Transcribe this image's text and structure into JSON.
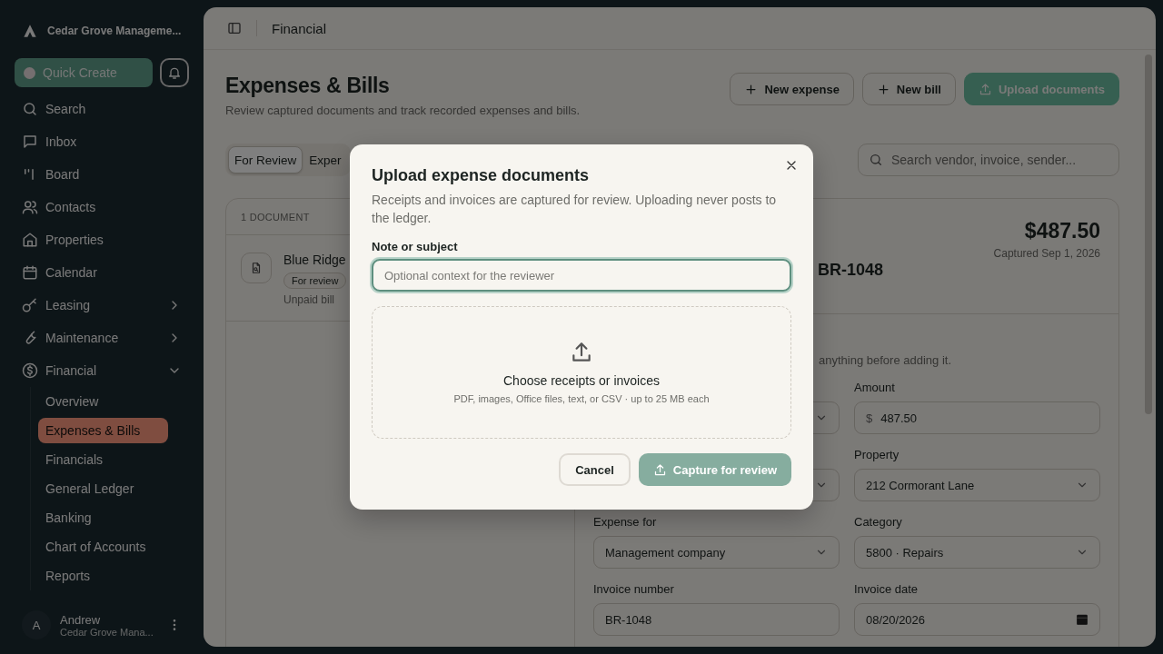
{
  "sidebar": {
    "brand": "Cedar Grove Manageme...",
    "quick_create": "Quick Create",
    "items": [
      {
        "label": "Search",
        "selected": false
      },
      {
        "label": "Inbox",
        "selected": false
      },
      {
        "label": "Board",
        "selected": false
      },
      {
        "label": "Contacts",
        "selected": false
      },
      {
        "label": "Properties",
        "selected": false
      },
      {
        "label": "Calendar",
        "selected": false
      },
      {
        "label": "Leasing",
        "selected": false,
        "expanded": false
      },
      {
        "label": "Maintenance",
        "selected": false,
        "expanded": false
      },
      {
        "label": "Financial",
        "selected": false,
        "expanded": true,
        "children": [
          {
            "label": "Overview",
            "selected": false
          },
          {
            "label": "Expenses & Bills",
            "selected": true
          },
          {
            "label": "Financials",
            "selected": false
          },
          {
            "label": "General Ledger",
            "selected": false
          },
          {
            "label": "Banking",
            "selected": false
          },
          {
            "label": "Chart of Accounts",
            "selected": false
          },
          {
            "label": "Reports",
            "selected": false
          }
        ]
      }
    ],
    "user": {
      "initial": "A",
      "name": "Andrew",
      "org": "Cedar Grove Mana..."
    }
  },
  "header": {
    "title": "Financial"
  },
  "page": {
    "title": "Expenses & Bills",
    "subtitle": "Review captured documents and track recorded expenses and bills.",
    "actions": [
      {
        "label": "New expense",
        "kind": "add"
      },
      {
        "label": "New bill",
        "kind": "add"
      },
      {
        "label": "Upload documents",
        "kind": "upload"
      }
    ],
    "tabs": [
      {
        "label": "For Review",
        "selected": true
      },
      {
        "label": "Exper",
        "selected": false
      }
    ],
    "search": {
      "placeholder": "Search vendor, invoice, sender..."
    },
    "list": {
      "count": "1 DOCUMENT",
      "items": [
        {
          "vendor": "Blue Ridge",
          "status": "For review",
          "type": "Unpaid bill"
        }
      ]
    },
    "detail": {
      "title": "BR-1048",
      "amount": "$487.50",
      "captured": "Captured Sep 1, 2026",
      "note": "anything before adding it.",
      "fields": [
        {
          "kind": "select"
        },
        {
          "label": "Amount",
          "kind": "money",
          "prefix": "$",
          "value": "487.50"
        },
        {
          "kind": "select"
        },
        {
          "label": "Property",
          "kind": "select",
          "value": "212 Cormorant Lane"
        },
        {
          "label": "Expense for",
          "kind": "select",
          "value": "Management company"
        },
        {
          "label": "Category",
          "kind": "select",
          "value": "5800 · Repairs"
        },
        {
          "label": "Invoice number",
          "kind": "text",
          "value": "BR-1048"
        },
        {
          "label": "Invoice date",
          "kind": "date",
          "value": "08/20/2026"
        }
      ]
    }
  },
  "modal": {
    "title": "Upload expense documents",
    "description": "Receipts and invoices are captured for review. Uploading never posts to the ledger.",
    "field": {
      "label": "Note or subject",
      "placeholder": "Optional context for the reviewer",
      "focused": true
    },
    "dropzone": {
      "title": "Choose receipts or invoices",
      "hint": "PDF, images, Office files, text, or CSV · up to 25 MB each"
    },
    "buttons": [
      {
        "label": "Cancel",
        "kind": "secondary",
        "disabled": false
      },
      {
        "label": "Capture for review",
        "kind": "primary",
        "disabled": true
      }
    ]
  }
}
